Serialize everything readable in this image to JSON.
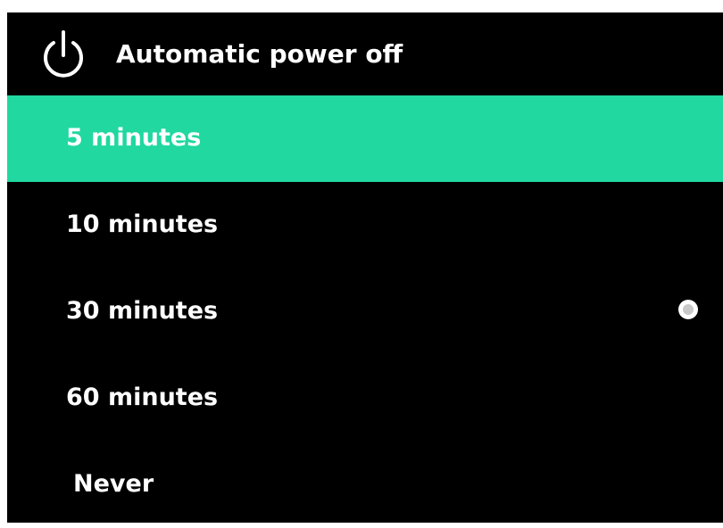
{
  "header": {
    "title": "Automatic power off",
    "icon": "power-icon"
  },
  "options": [
    {
      "label": "5 minutes",
      "highlighted": true,
      "checked": false
    },
    {
      "label": "10 minutes",
      "highlighted": false,
      "checked": false
    },
    {
      "label": "30 minutes",
      "highlighted": false,
      "checked": true
    },
    {
      "label": "60 minutes",
      "highlighted": false,
      "checked": false
    },
    {
      "label": "Never",
      "highlighted": false,
      "checked": false
    }
  ],
  "colors": {
    "background": "#000000",
    "highlight": "#20d8a0",
    "text": "#ffffff"
  }
}
